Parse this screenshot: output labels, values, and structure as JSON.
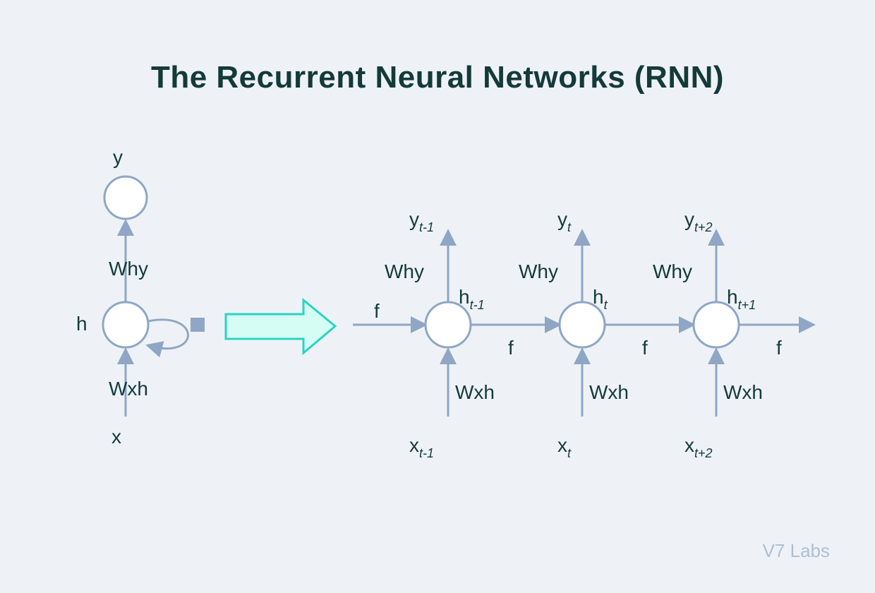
{
  "title": "The Recurrent Neural Networks (RNN)",
  "credit": "V7 Labs",
  "folded": {
    "y": "y",
    "h": "h",
    "x": "x",
    "why": "Why",
    "wxh": "Wxh"
  },
  "expand_f": "f",
  "unrolled": [
    {
      "y_main": "y",
      "y_sub": "t-1",
      "h_main": "h",
      "h_sub": "t-1",
      "x_main": "x",
      "x_sub": "t-1",
      "why": "Why",
      "wxh": "Wxh",
      "f": "f"
    },
    {
      "y_main": "y",
      "y_sub": "t",
      "h_main": "h",
      "h_sub": "t",
      "x_main": "x",
      "x_sub": "t",
      "why": "Why",
      "wxh": "Wxh",
      "f": "f"
    },
    {
      "y_main": "y",
      "y_sub": "t+2",
      "h_main": "h",
      "h_sub": "t+1",
      "x_main": "x",
      "x_sub": "t+2",
      "why": "Why",
      "wxh": "Wxh",
      "f": "f"
    }
  ]
}
